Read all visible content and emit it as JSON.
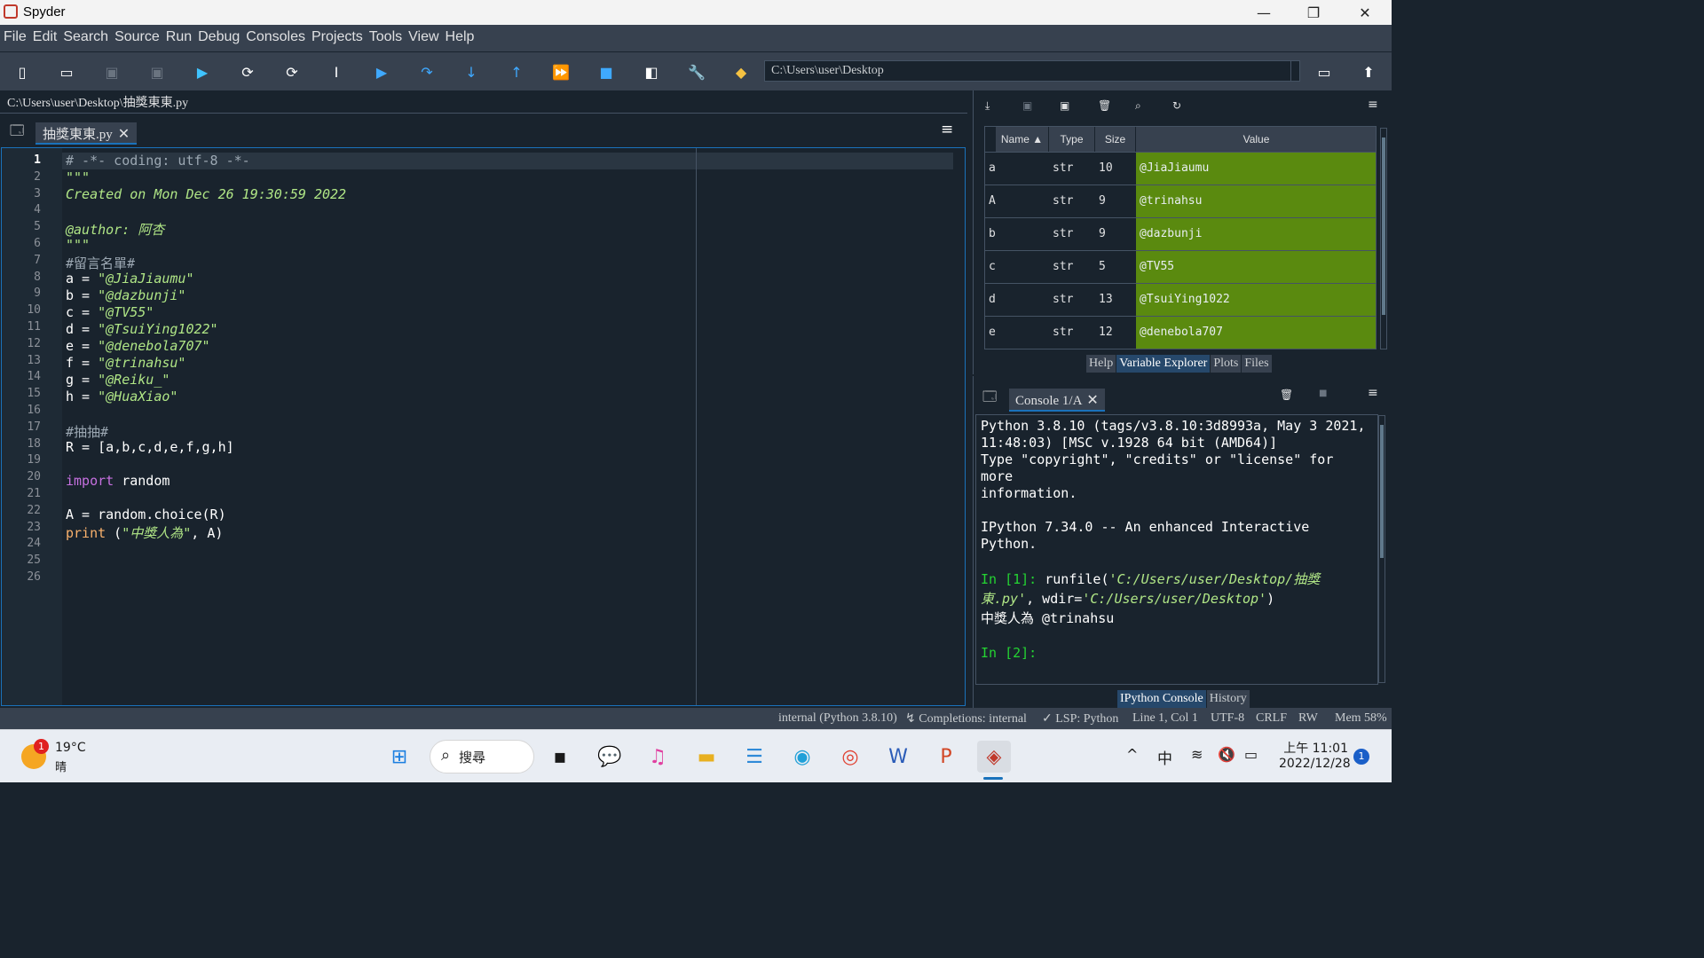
{
  "window": {
    "title": "Spyder",
    "minimize": "—",
    "restore": "❐",
    "close": "✕"
  },
  "menu": [
    "File",
    "Edit",
    "Search",
    "Source",
    "Run",
    "Debug",
    "Consoles",
    "Projects",
    "Tools",
    "View",
    "Help"
  ],
  "toolbar": {
    "path": "C:\\Users\\user\\Desktop"
  },
  "editor": {
    "filepath": "C:\\Users\\user\\Desktop\\抽獎東東.py",
    "tab_label": "抽獎東東.py",
    "line_numbers": [
      "1",
      "2",
      "3",
      "4",
      "5",
      "6",
      "7",
      "8",
      "9",
      "10",
      "11",
      "12",
      "13",
      "14",
      "15",
      "16",
      "17",
      "18",
      "19",
      "20",
      "21",
      "22",
      "23",
      "24",
      "25",
      "26"
    ],
    "lines": {
      "l1": "# -*- coding: utf-8 -*-",
      "l2": "\"\"\"",
      "l3": "Created on Mon Dec 26 19:30:59 2022",
      "l5": "@author: 阿杏",
      "l6": "\"\"\"",
      "l7": "#留言名單#",
      "l8a": "a = ",
      "l8b": "\"@JiaJiaumu\"",
      "l9a": "b = ",
      "l9b": "\"@dazbunji\"",
      "l10a": "c = ",
      "l10b": "\"@TV55\"",
      "l11a": "d = ",
      "l11b": "\"@TsuiYing1022\"",
      "l12a": "e = ",
      "l12b": "\"@denebola707\"",
      "l13a": "f = ",
      "l13b": "\"@trinahsu\"",
      "l14a": "g = ",
      "l14b": "\"@Reiku_\"",
      "l15a": "h = ",
      "l15b": "\"@HuaXiao\"",
      "l17": "#抽抽#",
      "l18": "R = [a,b,c,d,e,f,g,h]",
      "l20a": "import",
      "l20b": " random",
      "l22": "A = random.choice(R)",
      "l23a": "print",
      "l23b": " (",
      "l23c": "\"中獎人為\"",
      "l23d": ", A)"
    }
  },
  "variable_explorer": {
    "headers": {
      "name": "Name ▲",
      "type": "Type",
      "size": "Size",
      "value": "Value"
    },
    "rows": [
      {
        "name": "a",
        "type": "str",
        "size": "10",
        "value": "@JiaJiaumu"
      },
      {
        "name": "A",
        "type": "str",
        "size": "9",
        "value": "@trinahsu"
      },
      {
        "name": "b",
        "type": "str",
        "size": "9",
        "value": "@dazbunji"
      },
      {
        "name": "c",
        "type": "str",
        "size": "5",
        "value": "@TV55"
      },
      {
        "name": "d",
        "type": "str",
        "size": "13",
        "value": "@TsuiYing1022"
      },
      {
        "name": "e",
        "type": "str",
        "size": "12",
        "value": "@denebola707"
      }
    ],
    "tabs": [
      "Help",
      "Variable Explorer",
      "Plots",
      "Files"
    ]
  },
  "console": {
    "tab_label": "Console 1/A",
    "l1": "Python 3.8.10 (tags/v3.8.10:3d8993a, May  3 2021,",
    "l2": "11:48:03) [MSC v.1928 64 bit (AMD64)]",
    "l3": "Type \"copyright\", \"credits\" or \"license\" for more",
    "l4": "information.",
    "l5": "IPython 7.34.0 -- An enhanced Interactive Python.",
    "in1": "In [1]: ",
    "cmd_a": "runfile(",
    "cmd_b": "'C:/Users/user/Desktop/抽獎",
    "cmd_c": "東.py'",
    "cmd_d": ", wdir=",
    "cmd_e": "'C:/Users/user/Desktop'",
    "cmd_f": ")",
    "output": "中獎人為 @trinahsu",
    "in2": "In [2]:",
    "tabs": [
      "IPython Console",
      "History"
    ]
  },
  "status": {
    "interpreter": "internal (Python 3.8.10)",
    "completions": "Completions: internal",
    "lsp": "LSP: Python",
    "position": "Line 1, Col 1",
    "encoding": "UTF-8",
    "eol": "CRLF",
    "mode": "RW",
    "mem": "Mem 58%"
  },
  "taskbar": {
    "temp": "19°C",
    "weather": "晴",
    "weather_badge": "1",
    "search": "搜尋",
    "ime": "中",
    "time": "上午 11:01",
    "date": "2022/12/28",
    "notif": "1"
  }
}
